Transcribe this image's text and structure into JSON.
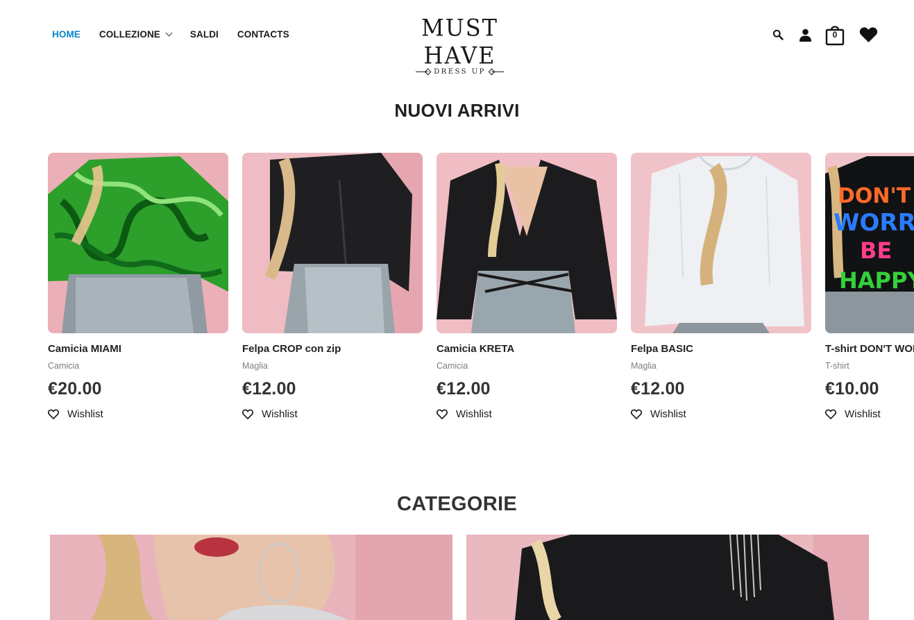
{
  "nav": {
    "items": [
      {
        "label": "HOME",
        "active": true
      },
      {
        "label": "COLLEZIONE",
        "has_dropdown": true
      },
      {
        "label": "SALDI"
      },
      {
        "label": "CONTACTS"
      }
    ]
  },
  "logo": {
    "main": "MUST HAVE",
    "sub": "DRESS UP"
  },
  "header_icons": {
    "search": "search-icon",
    "account": "account-icon",
    "cart": "cart-icon",
    "cart_count": "0",
    "wishlist": "heart-icon"
  },
  "sections": {
    "new_arrivals_title": "NUOVI ARRIVI",
    "categories_title": "CATEGORIE"
  },
  "products": [
    {
      "name": "Camicia MIAMI",
      "category": "Camicia",
      "price": "€20.00",
      "wishlist_label": "Wishlist"
    },
    {
      "name": "Felpa CROP con zip",
      "category": "Maglia",
      "price": "€12.00",
      "wishlist_label": "Wishlist"
    },
    {
      "name": "Camicia KRETA",
      "category": "Camicia",
      "price": "€12.00",
      "wishlist_label": "Wishlist"
    },
    {
      "name": "Felpa BASIC",
      "category": "Maglia",
      "price": "€12.00",
      "wishlist_label": "Wishlist"
    },
    {
      "name": "T-shirt DON'T WORRY BE HAPPY",
      "category": "T-shirt",
      "price": "€10.00",
      "wishlist_label": "Wishlist"
    }
  ],
  "colors": {
    "accent": "#0a82c8",
    "text": "#1a1a1a",
    "muted": "#7d7d7d",
    "background_pink": "#f1c9cc"
  }
}
